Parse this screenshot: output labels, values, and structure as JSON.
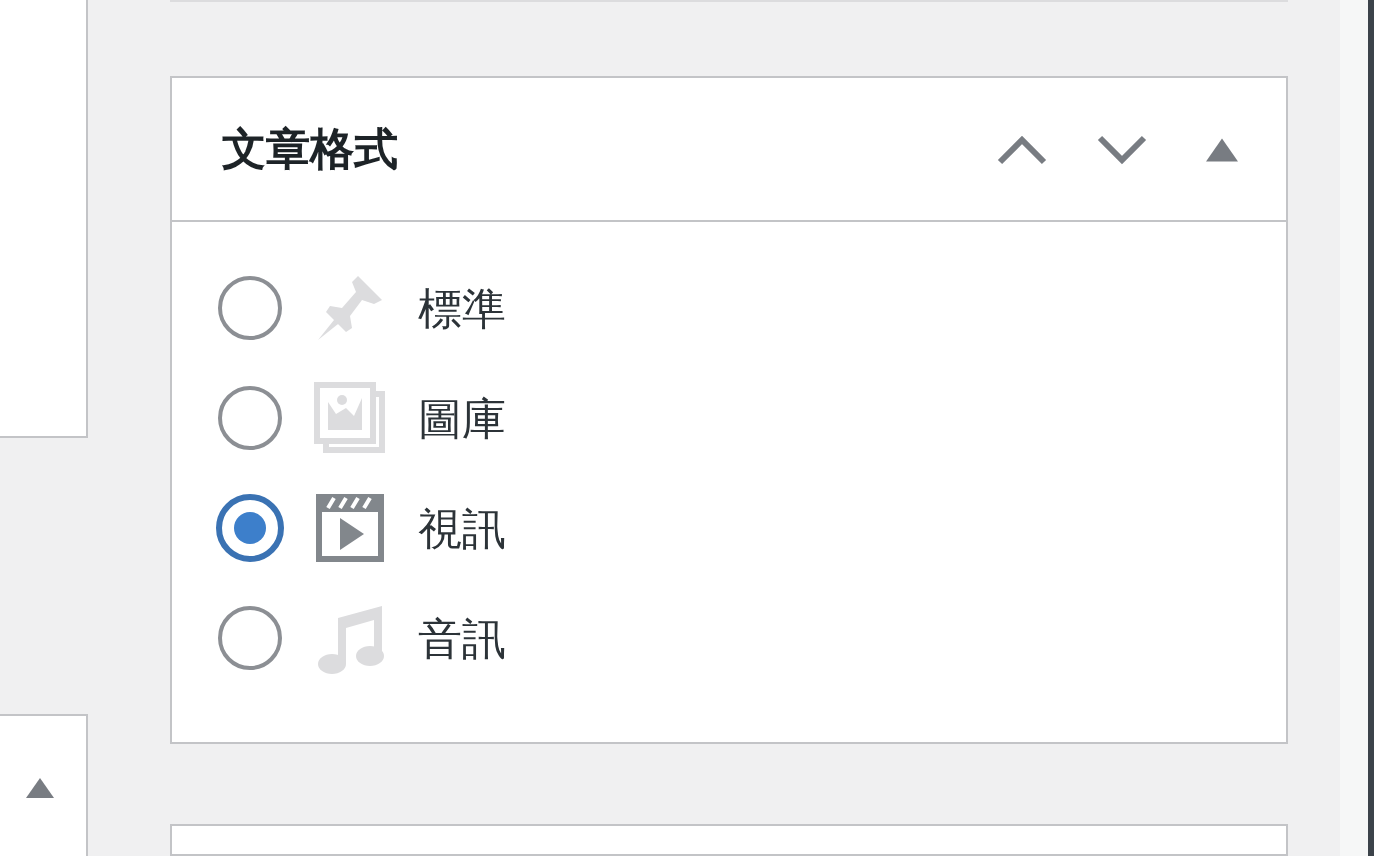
{
  "panel": {
    "title": "文章格式",
    "controls": [
      {
        "kind": "up"
      },
      {
        "kind": "down"
      },
      {
        "kind": "toggle"
      }
    ]
  },
  "formats": [
    {
      "label": "標準",
      "kind": "standard",
      "selected": false
    },
    {
      "label": "圖庫",
      "kind": "gallery",
      "selected": false
    },
    {
      "label": "視訊",
      "kind": "video",
      "selected": true
    },
    {
      "label": "音訊",
      "kind": "audio",
      "selected": false
    }
  ]
}
